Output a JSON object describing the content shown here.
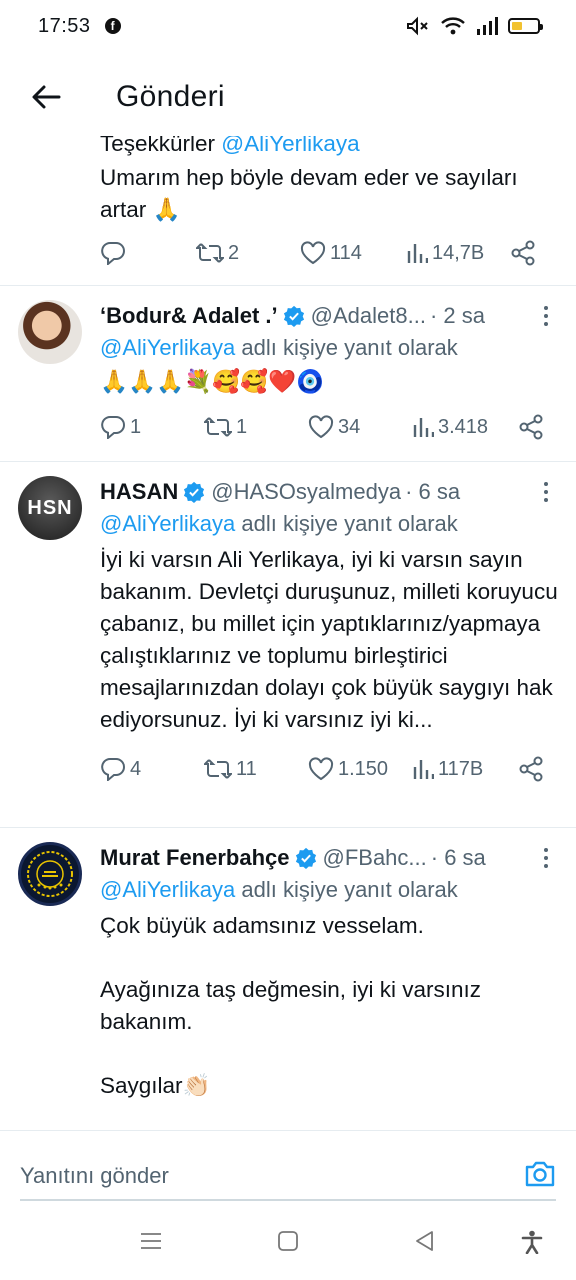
{
  "status_bar": {
    "time": "17:53",
    "app_icon": "facebook-icon",
    "icons": [
      "mute-icon",
      "wifi-icon",
      "signal-icon",
      "battery-icon"
    ],
    "battery_color": "#f2c230"
  },
  "header": {
    "title": "Gönderi",
    "back_icon": "arrow-left-icon"
  },
  "top_tweet": {
    "cut_text_prefix": "Teşekkürler ",
    "cut_mention": "@AliYerlikaya",
    "text": "Umarım hep böyle devam eder ve sayıları artar 🙏",
    "stats": {
      "replies": "",
      "retweets": "2",
      "likes": "114",
      "views": "14,7B"
    }
  },
  "replies": [
    {
      "name": "‘Bodur& Adalet .’",
      "handle": "@Adalet8...",
      "time": "· 2 sa",
      "reply_to_mention": "@AliYerlikaya",
      "reply_to_suffix": " adlı kişiye yanıt olarak",
      "text": "🙏🙏🙏💐🥰🥰❤️🧿",
      "stats": {
        "replies": "1",
        "retweets": "1",
        "likes": "34",
        "views": "3.418"
      }
    },
    {
      "name": "HASAN",
      "avatar_text": "HSN",
      "handle": "@HASOsyalmedya",
      "time": "· 6 sa",
      "reply_to_mention": "@AliYerlikaya",
      "reply_to_suffix": " adlı kişiye yanıt olarak",
      "text": "İyi ki varsın Ali Yerlikaya, iyi ki varsın sayın bakanım. Devletçi duruşunuz, milleti koruyucu çabanız, bu millet için yaptıklarınız/yapmaya çalıştıklarınız ve toplumu birleştirici mesajlarınızdan dolayı çok büyük saygıyı hak ediyorsunuz. İyi ki varsınız iyi ki...",
      "stats": {
        "replies": "4",
        "retweets": "11",
        "likes": "1.150",
        "views": "117B"
      }
    },
    {
      "name": "Murat Fenerbahçe",
      "handle": "@FBahc...",
      "time": "· 6 sa",
      "reply_to_mention": "@AliYerlikaya",
      "reply_to_suffix": " adlı kişiye yanıt olarak",
      "text_lines": [
        "Çok büyük adamsınız vesselam.",
        "Ayağınıza taş değmesin, iyi ki varsınız bakanım.",
        "Saygılar👏🏻"
      ]
    }
  ],
  "reply_bar": {
    "placeholder": "Yanıtını gönder",
    "camera_icon": "camera-icon",
    "accent": "#1d9bf0"
  },
  "nav_bar": {
    "icons": [
      "menu-icon",
      "home-square-icon",
      "back-triangle-icon",
      "accessibility-icon"
    ]
  }
}
